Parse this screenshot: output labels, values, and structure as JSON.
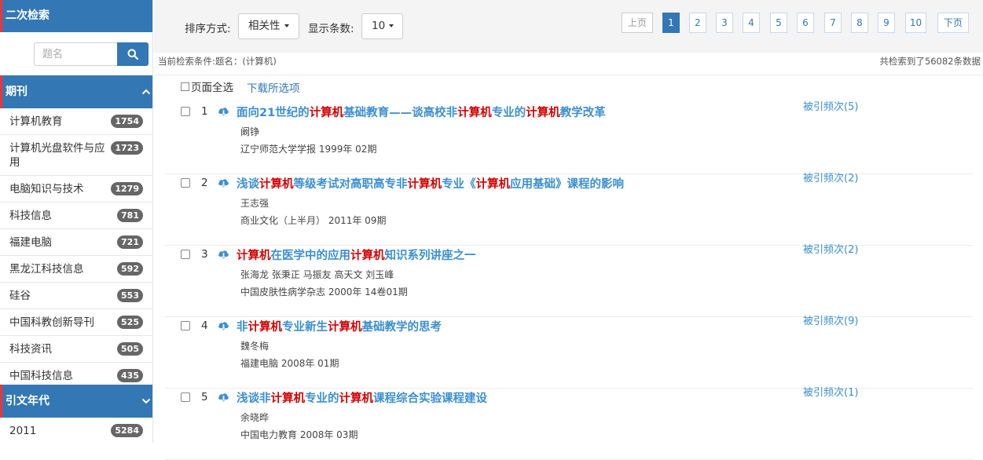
{
  "sidebar": {
    "secondary_search_title": "二次检索",
    "search_placeholder": "题名",
    "journal_section_title": "期刊",
    "journals": [
      {
        "name": "计算机教育",
        "count": "1754"
      },
      {
        "name": "计算机光盘软件与应用",
        "count": "1723"
      },
      {
        "name": "电脑知识与技术",
        "count": "1279"
      },
      {
        "name": "科技信息",
        "count": "781"
      },
      {
        "name": "福建电脑",
        "count": "721"
      },
      {
        "name": "黑龙江科技信息",
        "count": "592"
      },
      {
        "name": "硅谷",
        "count": "553"
      },
      {
        "name": "中国科教创新导刊",
        "count": "525"
      },
      {
        "name": "科技资讯",
        "count": "505"
      },
      {
        "name": "中国科技信息",
        "count": "435"
      }
    ],
    "year_section_title": "引文年代",
    "years": [
      {
        "name": "2011",
        "count": "5284"
      }
    ],
    "accent_color": "#3377b5",
    "marker_color": "#e8363c"
  },
  "toolbar": {
    "sort_label": "排序方式:",
    "sort_value": "相关性",
    "count_label": "显示条数:",
    "count_value": "10",
    "prev_label": "上页",
    "next_label": "下页",
    "pages": [
      "1",
      "2",
      "3",
      "4",
      "5",
      "6",
      "7",
      "8",
      "9",
      "10"
    ],
    "current_page": "1"
  },
  "conditions": {
    "text": "当前检索条件:题名：(计算机)",
    "total": "共检索到了56082条数据"
  },
  "actions": {
    "select_all": "页面全选",
    "download_selected": "下载所选项"
  },
  "results": [
    {
      "index": "1",
      "title_parts": [
        {
          "t": "面向21世纪的",
          "hl": false
        },
        {
          "t": "计算机",
          "hl": true
        },
        {
          "t": "基础教育——谈高校非",
          "hl": false
        },
        {
          "t": "计算机",
          "hl": true
        },
        {
          "t": "专业的",
          "hl": false
        },
        {
          "t": "计算机",
          "hl": true
        },
        {
          "t": "教学改革",
          "hl": false
        }
      ],
      "authors": "阚铮",
      "source": "辽宁师范大学学报 1999年 02期",
      "cited": "被引频次(5)"
    },
    {
      "index": "2",
      "title_parts": [
        {
          "t": "浅谈",
          "hl": false
        },
        {
          "t": "计算机",
          "hl": true
        },
        {
          "t": "等级考试对高职高专非",
          "hl": false
        },
        {
          "t": "计算机",
          "hl": true
        },
        {
          "t": "专业《",
          "hl": false
        },
        {
          "t": "计算机",
          "hl": true
        },
        {
          "t": "应用基础》课程的影响",
          "hl": false
        }
      ],
      "authors": "王志强",
      "source": "商业文化（上半月） 2011年 09期",
      "cited": "被引频次(2)"
    },
    {
      "index": "3",
      "title_parts": [
        {
          "t": "计算机",
          "hl": true
        },
        {
          "t": "在医学中的应用",
          "hl": false
        },
        {
          "t": "计算机",
          "hl": true
        },
        {
          "t": "知识系列讲座之一",
          "hl": false
        }
      ],
      "authors": "张海龙 张秉正 马振友 高天文 刘玉峰",
      "source": "中国皮肤性病学杂志 2000年 14卷01期",
      "cited": "被引频次(2)"
    },
    {
      "index": "4",
      "title_parts": [
        {
          "t": "非",
          "hl": false
        },
        {
          "t": "计算机",
          "hl": true
        },
        {
          "t": "专业新生",
          "hl": false
        },
        {
          "t": "计算机",
          "hl": true
        },
        {
          "t": "基础教学的思考",
          "hl": false
        }
      ],
      "authors": "魏冬梅",
      "source": "福建电脑 2008年 01期",
      "cited": "被引频次(9)"
    },
    {
      "index": "5",
      "title_parts": [
        {
          "t": "浅谈非",
          "hl": false
        },
        {
          "t": "计算机",
          "hl": true
        },
        {
          "t": "专业的",
          "hl": false
        },
        {
          "t": "计算机",
          "hl": true
        },
        {
          "t": "课程综合实验课程建设",
          "hl": false
        }
      ],
      "authors": "余晓晔",
      "source": "中国电力教育 2008年 03期",
      "cited": "被引频次(1)"
    }
  ],
  "colors": {
    "link": "#3b8fd1",
    "highlight": "#d40000"
  }
}
